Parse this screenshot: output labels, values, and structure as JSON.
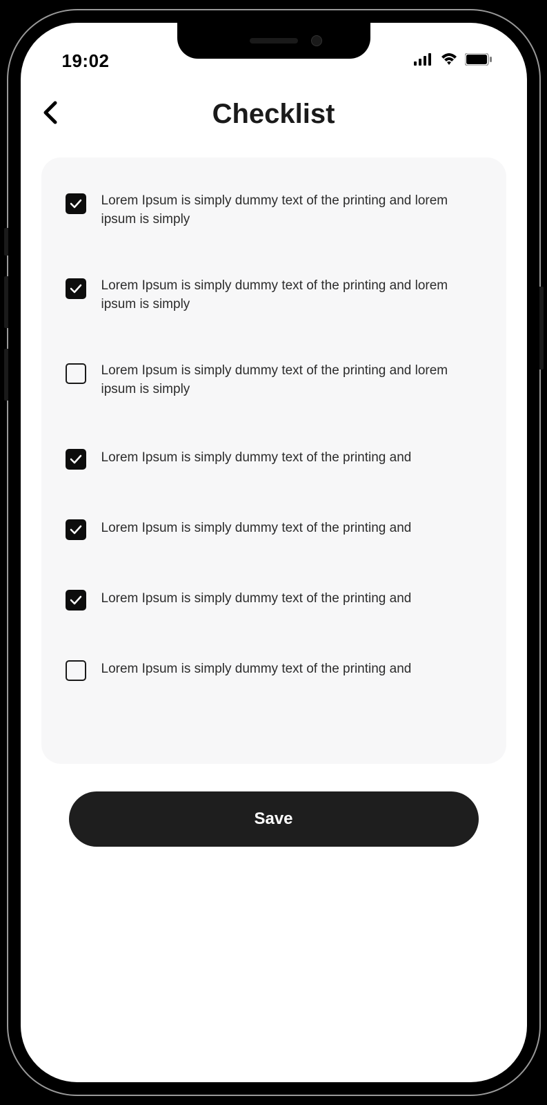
{
  "status": {
    "time": "19:02"
  },
  "header": {
    "title": "Checklist"
  },
  "items": [
    {
      "text": "Lorem Ipsum is simply dummy text of the printing and lorem ipsum is simply",
      "checked": true
    },
    {
      "text": "Lorem Ipsum is simply dummy text of the printing and lorem ipsum is simply",
      "checked": true
    },
    {
      "text": "Lorem Ipsum is simply dummy text of the printing and lorem ipsum is simply",
      "checked": false
    },
    {
      "text": "Lorem Ipsum is simply dummy text of the printing and",
      "checked": true
    },
    {
      "text": "Lorem Ipsum is simply dummy text of the printing and",
      "checked": true
    },
    {
      "text": "Lorem Ipsum is simply dummy text of the printing and",
      "checked": true
    },
    {
      "text": "Lorem Ipsum is simply dummy text of the printing and",
      "checked": false
    }
  ],
  "actions": {
    "save_label": "Save"
  }
}
